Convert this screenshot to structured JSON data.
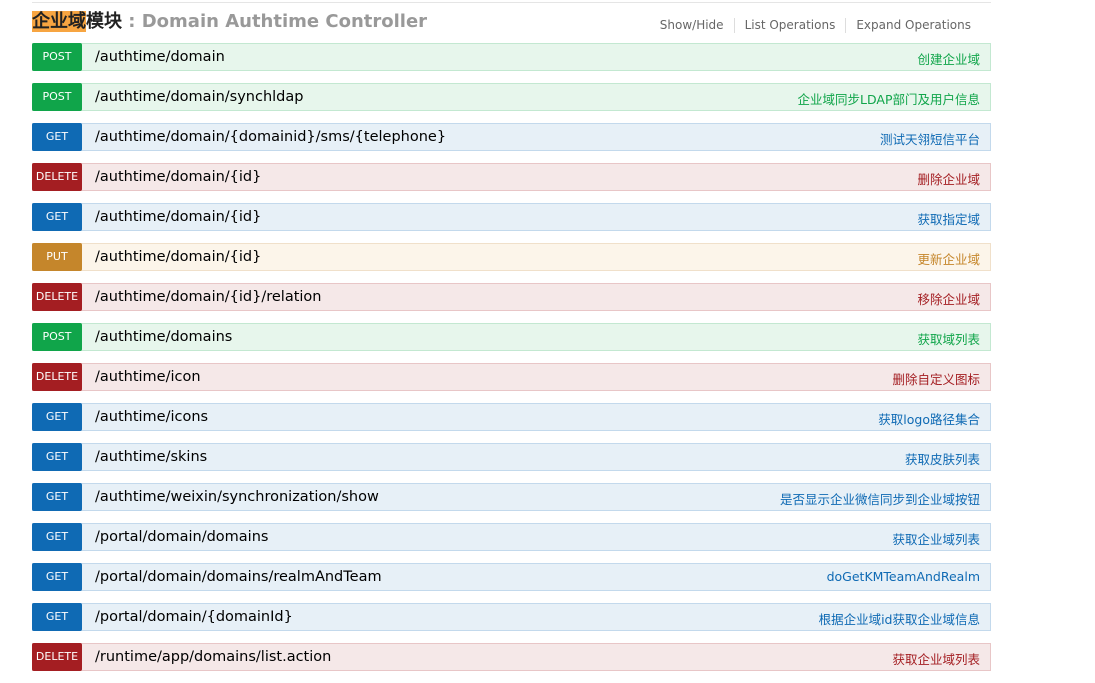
{
  "header": {
    "title_highlight": "企业域",
    "title_cn_rest": "模块",
    "title_en": " : Domain Authtime Controller",
    "show_hide": "Show/Hide",
    "list_operations": "List Operations",
    "expand_operations": "Expand Operations"
  },
  "endpoints": [
    {
      "method": "POST",
      "path": "/authtime/domain",
      "desc": "创建企业域"
    },
    {
      "method": "POST",
      "path": "/authtime/domain/synchldap",
      "desc": "企业域同步LDAP部门及用户信息"
    },
    {
      "method": "GET",
      "path": "/authtime/domain/{domainid}/sms/{telephone}",
      "desc": "测试天翎短信平台"
    },
    {
      "method": "DELETE",
      "path": "/authtime/domain/{id}",
      "desc": "删除企业域"
    },
    {
      "method": "GET",
      "path": "/authtime/domain/{id}",
      "desc": "获取指定域"
    },
    {
      "method": "PUT",
      "path": "/authtime/domain/{id}",
      "desc": "更新企业域"
    },
    {
      "method": "DELETE",
      "path": "/authtime/domain/{id}/relation",
      "desc": "移除企业域"
    },
    {
      "method": "POST",
      "path": "/authtime/domains",
      "desc": "获取域列表"
    },
    {
      "method": "DELETE",
      "path": "/authtime/icon",
      "desc": "删除自定义图标"
    },
    {
      "method": "GET",
      "path": "/authtime/icons",
      "desc": "获取logo路径集合"
    },
    {
      "method": "GET",
      "path": "/authtime/skins",
      "desc": "获取皮肤列表"
    },
    {
      "method": "GET",
      "path": "/authtime/weixin/synchronization/show",
      "desc": "是否显示企业微信同步到企业域按钮"
    },
    {
      "method": "GET",
      "path": "/portal/domain/domains",
      "desc": "获取企业域列表"
    },
    {
      "method": "GET",
      "path": "/portal/domain/domains/realmAndTeam",
      "desc": "doGetKMTeamAndRealm"
    },
    {
      "method": "GET",
      "path": "/portal/domain/{domainId}",
      "desc": "根据企业域id获取企业域信息"
    },
    {
      "method": "DELETE",
      "path": "/runtime/app/domains/list.action",
      "desc": "获取企业域列表"
    }
  ]
}
